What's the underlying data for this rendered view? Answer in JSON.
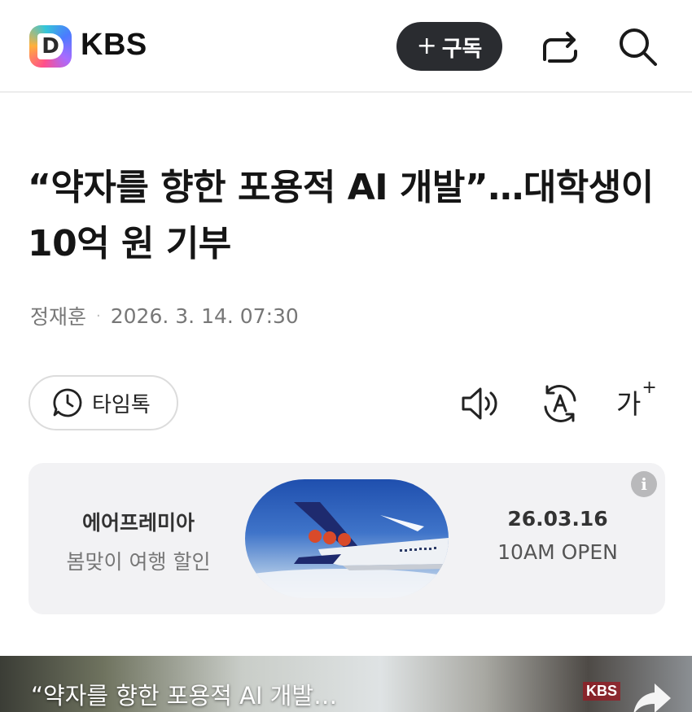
{
  "header": {
    "logo_letter": "D",
    "brand": "KBS",
    "subscribe_plus": "+",
    "subscribe_label": "구독",
    "icons": [
      "share-icon",
      "search-icon"
    ]
  },
  "article": {
    "headline": "“약자를 향한 포용적 AI 개발”…대학생이 10억 원 기부",
    "author": "정재훈",
    "separator": "·",
    "datetime": "2026. 3. 14. 07:30"
  },
  "toolbar": {
    "timetalk_label": "타임톡",
    "font_size_label": "가",
    "font_size_plus": "+",
    "icons": [
      "clock-chat-icon",
      "speaker-icon",
      "auto-read-icon",
      "font-size-icon"
    ]
  },
  "ad": {
    "info_label": "i",
    "brand": "에어프레미아",
    "tagline": "봄맞이 여행 할인",
    "date": "26.03.16",
    "open_label": "10AM OPEN",
    "colors": {
      "sky": "#2c5fbb",
      "tail": "#1e2a6e",
      "dots": "#d94a2a"
    }
  },
  "video": {
    "title": "“약자를 향한 포용적 AI 개발…",
    "watermark": "KBS"
  }
}
